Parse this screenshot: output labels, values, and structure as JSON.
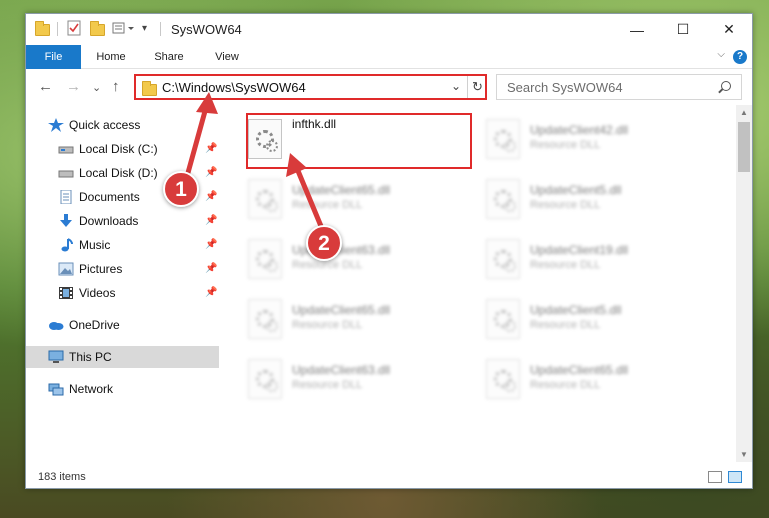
{
  "window": {
    "title": "SysWOW64",
    "controls": {
      "minimize": "—",
      "maximize": "☐",
      "close": "✕"
    }
  },
  "ribbon": {
    "tabs": [
      "File",
      "Home",
      "Share",
      "View"
    ],
    "help": "?",
    "expand": "⌵"
  },
  "nav": {
    "back": "←",
    "forward": "→",
    "recent": "⌄",
    "up": "↑"
  },
  "address": {
    "path": "C:\\Windows\\SysWOW64",
    "dropdown": "⌄",
    "refresh": "↻"
  },
  "search": {
    "placeholder": "Search SysWOW64"
  },
  "sidebar": {
    "items": [
      {
        "label": "Quick access",
        "icon": "star-icon",
        "pinned": false
      },
      {
        "label": "Local Disk (C:)",
        "icon": "drive-icon",
        "pinned": true
      },
      {
        "label": "Local Disk (D:)",
        "icon": "drive-icon",
        "pinned": true
      },
      {
        "label": "Documents",
        "icon": "documents-icon",
        "pinned": true
      },
      {
        "label": "Downloads",
        "icon": "download-icon",
        "pinned": true
      },
      {
        "label": "Music",
        "icon": "music-icon",
        "pinned": true
      },
      {
        "label": "Pictures",
        "icon": "pictures-icon",
        "pinned": true
      },
      {
        "label": "Videos",
        "icon": "videos-icon",
        "pinned": true
      },
      {
        "label": "OneDrive",
        "icon": "cloud-icon",
        "pinned": false
      },
      {
        "label": "This PC",
        "icon": "computer-icon",
        "pinned": false,
        "selected": true
      },
      {
        "label": "Network",
        "icon": "network-icon",
        "pinned": false
      }
    ],
    "pin_glyph": "📌"
  },
  "files": {
    "col1": [
      {
        "name": "infthk.dll",
        "type": ""
      },
      {
        "name": "UpdateClient65.dll",
        "type": "Resource DLL"
      },
      {
        "name": "UpdateClient63.dll",
        "type": "Resource DLL"
      },
      {
        "name": "UpdateClient65.dll",
        "type": "Resource DLL"
      },
      {
        "name": "UpdateClient63.dll",
        "type": "Resource DLL"
      }
    ],
    "col2": [
      {
        "name": "UpdateClient42.dll",
        "type": "Resource DLL"
      },
      {
        "name": "UpdateClient5.dll",
        "type": "Resource DLL"
      },
      {
        "name": "UpdateClient19.dll",
        "type": "Resource DLL"
      },
      {
        "name": "UpdateClient5.dll",
        "type": "Resource DLL"
      },
      {
        "name": "UpdateClient65.dll",
        "type": "Resource DLL"
      }
    ]
  },
  "status": {
    "count": "183 items"
  },
  "callouts": {
    "one": "1",
    "two": "2"
  },
  "colors": {
    "accent": "#1979ca",
    "highlight": "#e02a2a",
    "callout": "#d83b3b"
  }
}
